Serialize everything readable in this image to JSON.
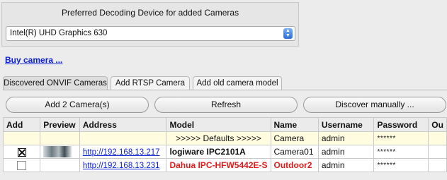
{
  "decoding": {
    "title": "Preferred Decoding Device for added Cameras",
    "selected": "Intel(R) UHD Graphics 630"
  },
  "buy_link": "Buy camera ...",
  "tabs": [
    {
      "label": "Discovered ONVIF Cameras",
      "active": true
    },
    {
      "label": "Add RTSP Camera",
      "active": false
    },
    {
      "label": "Add old camera model",
      "active": false
    }
  ],
  "buttons": {
    "add": "Add 2 Camera(s)",
    "refresh": "Refresh",
    "discover": "Discover manually ..."
  },
  "table": {
    "columns": [
      "Add",
      "Preview",
      "Address",
      "Model",
      "Name",
      "Username",
      "Password",
      "Ou"
    ],
    "defaults_row": {
      "model": ">>>>> Defaults >>>>>",
      "name": "Camera",
      "username": "admin",
      "password": "******"
    },
    "rows": [
      {
        "checked": true,
        "address": "http://192.168.13.217",
        "model": "logiware IPC2101A",
        "name": "Camera01",
        "username": "admin",
        "password": "******"
      },
      {
        "checked": false,
        "address": "http://192.168.13.231",
        "model": "Dahua IPC-HFW5442E-S",
        "name": "Outdoor2",
        "username": "admin",
        "password": "******"
      }
    ]
  },
  "colors": {
    "link": "#0a1fd6",
    "error_red": "#e01b1b",
    "defaults_row_bg": "#fffce0"
  }
}
